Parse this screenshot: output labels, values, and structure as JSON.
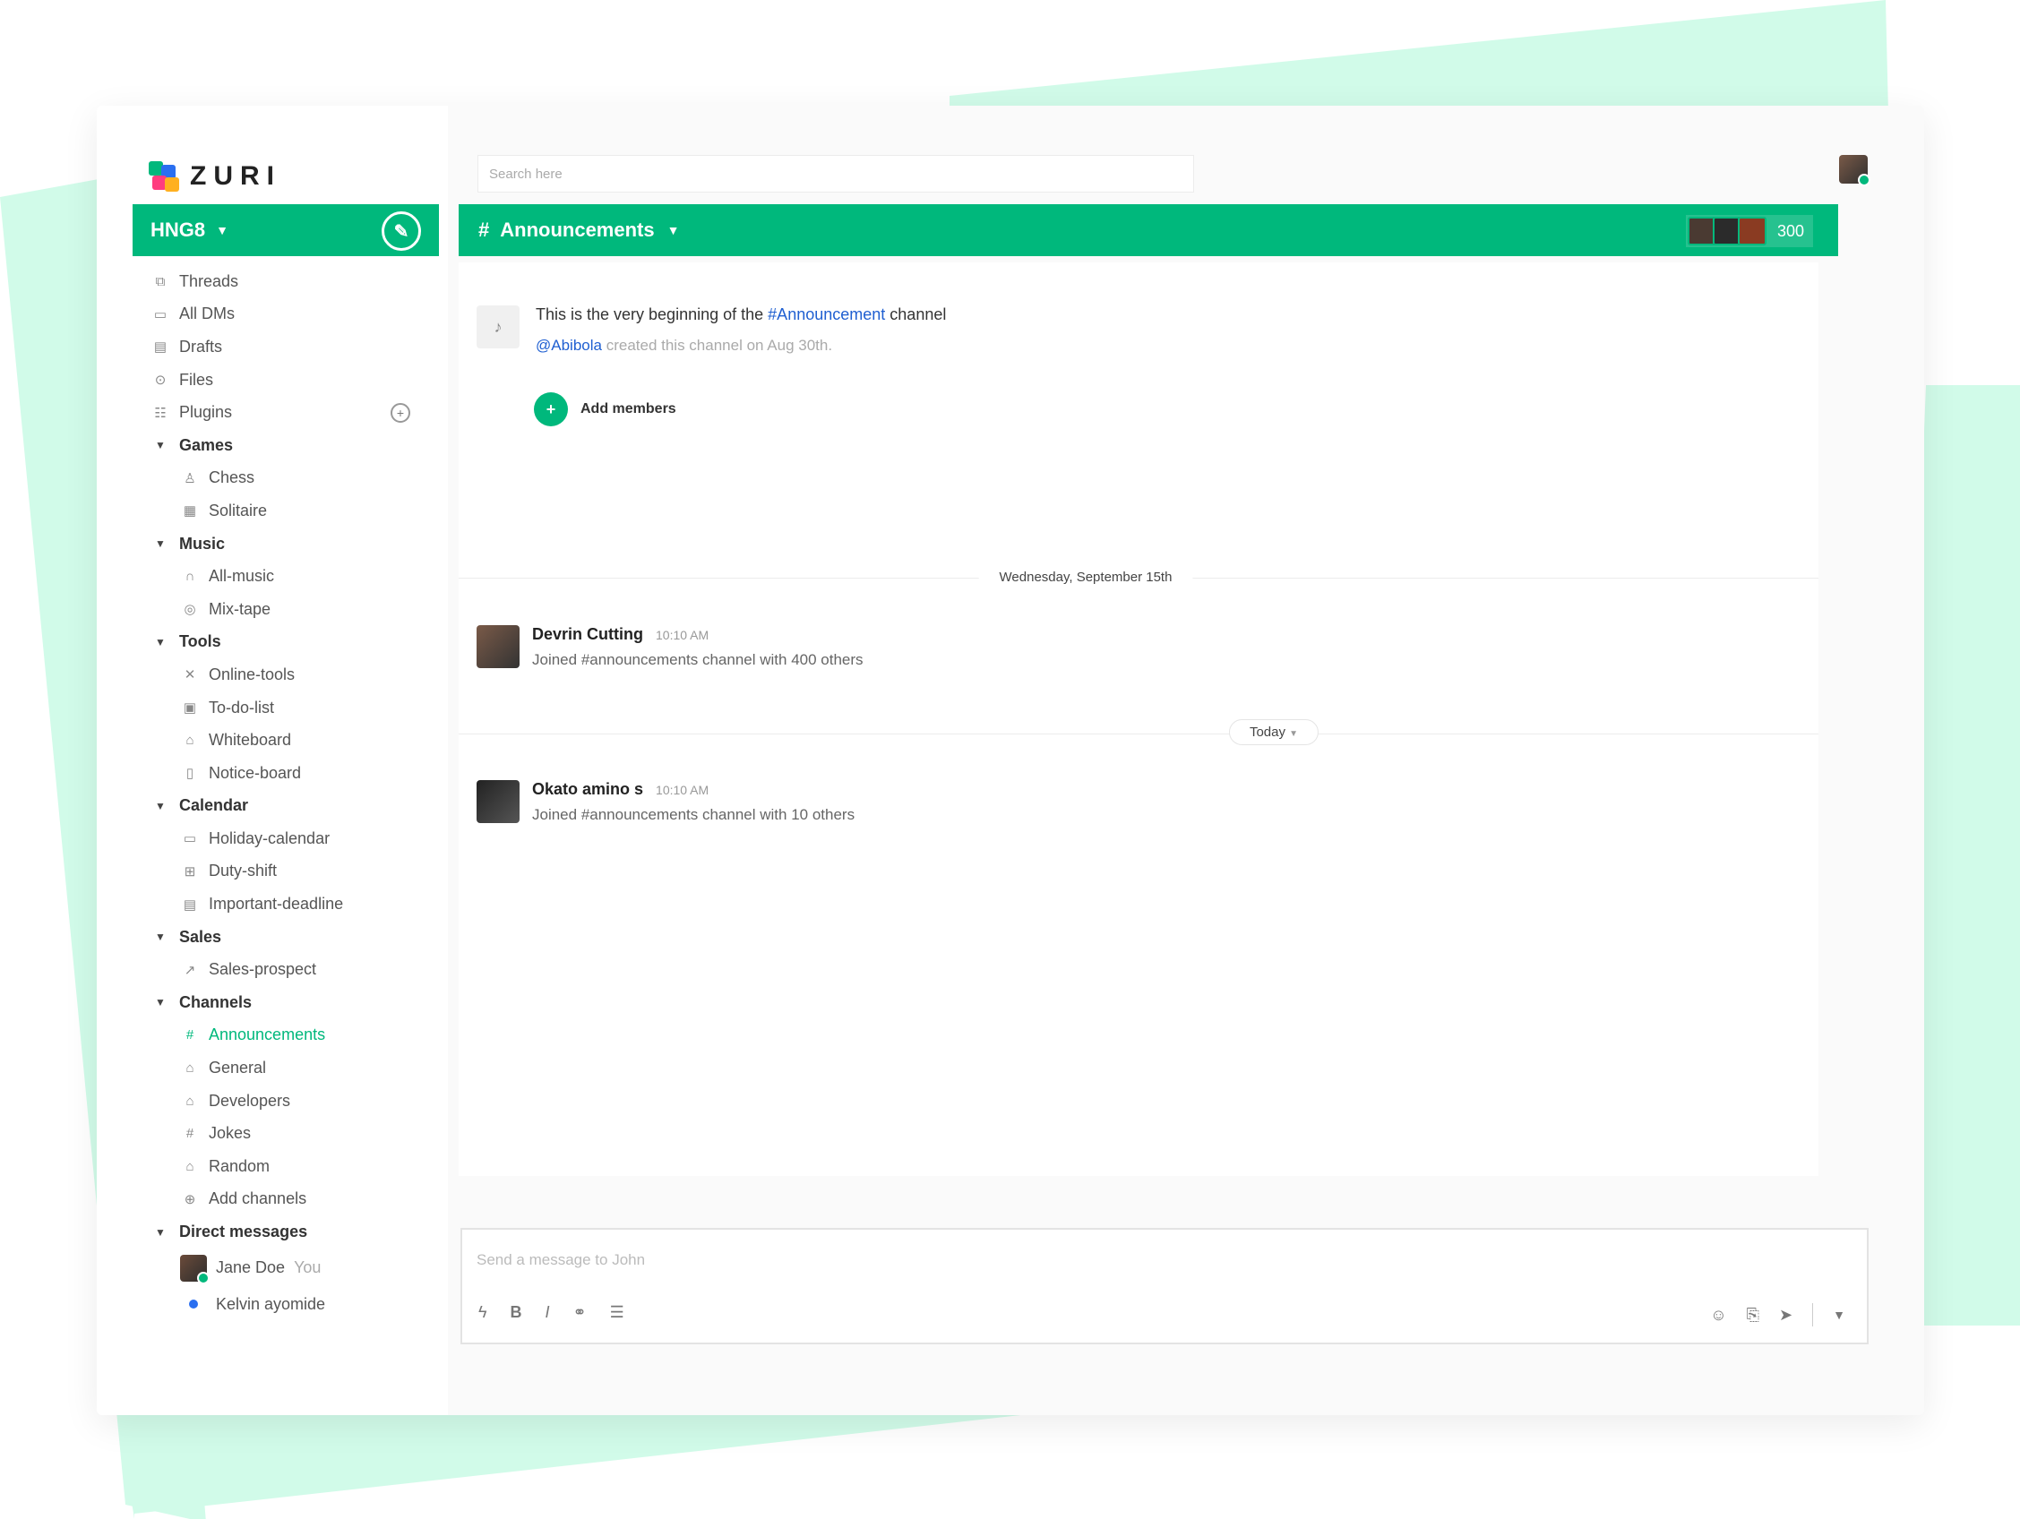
{
  "app": {
    "name": "ZURI",
    "workspace": "HNG8"
  },
  "search": {
    "placeholder": "Search here"
  },
  "nav": {
    "top_items": [
      {
        "label": "Threads",
        "icon": "threads-icon"
      },
      {
        "label": "All DMs",
        "icon": "dm-icon"
      },
      {
        "label": "Drafts",
        "icon": "drafts-icon"
      },
      {
        "label": "Files",
        "icon": "files-icon"
      },
      {
        "label": "Plugins",
        "icon": "plugins-icon"
      }
    ],
    "sections": [
      {
        "label": "Games",
        "items": [
          "Chess",
          "Solitaire"
        ]
      },
      {
        "label": "Music",
        "items": [
          "All-music",
          "Mix-tape"
        ]
      },
      {
        "label": "Tools",
        "items": [
          "Online-tools",
          "To-do-list",
          "Whiteboard",
          "Notice-board"
        ]
      },
      {
        "label": "Calendar",
        "items": [
          "Holiday-calendar",
          "Duty-shift",
          "Important-deadline"
        ]
      },
      {
        "label": "Sales",
        "items": [
          "Sales-prospect"
        ]
      },
      {
        "label": "Channels",
        "items": [
          "Announcements",
          "General",
          "Developers",
          "Jokes",
          "Random",
          "Add channels"
        ]
      },
      {
        "label": "Direct messages",
        "items": [
          "Jane Doe",
          "Kelvin ayomide"
        ]
      }
    ],
    "you_label": "You"
  },
  "channel": {
    "name": "Announcements",
    "member_count": "300"
  },
  "intro": {
    "line1_prefix": "This is the very beginning of the",
    "channel_link": "#Announcement",
    "line1_suffix": "channel",
    "creator": "@Abibola",
    "line2_suffix": "created this channel on Aug 30th.",
    "add_members": "Add members"
  },
  "dividers": {
    "date1": "Wednesday, September 15th",
    "date2": "Today"
  },
  "messages": [
    {
      "name": "Devrin Cutting",
      "time": "10:10 AM",
      "body": "Joined #announcements channel with 400 others"
    },
    {
      "name": "Okato amino s",
      "time": "10:10 AM",
      "body": "Joined #announcements channel with 10 others"
    }
  ],
  "composer": {
    "placeholder": "Send a message to John"
  },
  "colors": {
    "brand": "#00b87c",
    "link": "#1f5fd1",
    "deco": "#d1fbe9"
  }
}
